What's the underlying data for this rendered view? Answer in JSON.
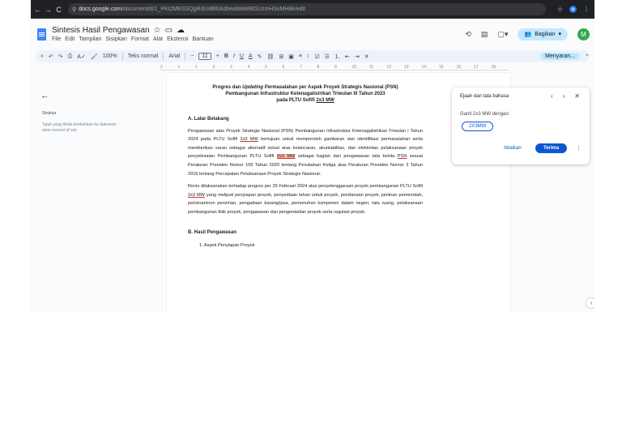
{
  "browser": {
    "nav_back": "←",
    "nav_forward": "→",
    "nav_reload": "C",
    "url_host": "docs.google.com",
    "url_path": "/document/d/1_PKt2MESSQgRdU4Bl0Ad6eaWaWBGUzmHSsMH8k/edit",
    "star": "☆"
  },
  "header": {
    "doc_title": "Sintesis Hasil Pengawasan",
    "menu": [
      "File",
      "Edit",
      "Tampilan",
      "Sisipkan",
      "Format",
      "Alat",
      "Ekstensi",
      "Bantuan"
    ],
    "share_label": "Bagikan",
    "avatar_letter": "M"
  },
  "toolbar": {
    "zoom": "100%",
    "style": "Teks normal",
    "font": "Arial",
    "font_size": "11",
    "mode_label": "Menyaran..."
  },
  "ruler": {
    "ticks": [
      "2",
      "1",
      "1",
      "2",
      "3",
      "4",
      "5",
      "6",
      "7",
      "8",
      "9",
      "10",
      "11",
      "12",
      "13",
      "14",
      "15",
      "16",
      "17",
      "18"
    ]
  },
  "outline": {
    "title": "Struktur",
    "hint": "Tajuk yang Anda tambahkan ke dokumen akan muncul di sini."
  },
  "document": {
    "title_line1_a": "Progres dan ",
    "title_line1_b": "Updating",
    "title_line1_c": " Permasalahan per Aspek Proyek Strategis Nasional (PSN)",
    "title_line2": "Pembangunan Infrastruktur Ketenagalistrikan Triwulan III Tahun 2023",
    "title_line3_a": "pada PLTU Sofifi ",
    "title_line3_b": "2x3 MW",
    "section_a": "A. Latar Belakang",
    "p1_a": "Pengawasan atas Proyek Strategis Nasional (PSN) Pembangunan Infrastruktur Ketenagalistrikan Triwulan I Tahun 2024 pada PLTU Sofifi ",
    "p1_b": "2x3 MW",
    "p1_c": " bertujuan untuk memperoleh gambaran dan identifikasi permasalahan serta memberikan saran sebagai alternatif solusi atas kelancaran, akuntabilitas, dan efektivitas pelaksanaan proyek penyelesaian Pembangunan PLTU Sofifi ",
    "p1_d": "2x3 MW",
    "p1_e": " sebagai bagian dari pengawasan tata kelola ",
    "p1_f": "PSN",
    "p1_g": " sesuai Peraturan Presiden Nomor 109 Tahun 2020 tentang Perubahan Ketiga atas Peraturan Presiden Nomor 3 Tahun 2016 tentang Percepatan Pelaksanaan Proyek Strategis Nasional.",
    "p2_a": "Reviu dilaksanakan terhadap progres per 29 Februari 2024 atas penyelenggaraan proyek pembangunan PLTU Sofifi ",
    "p2_b": "2x3 MW",
    "p2_c": " yang meliputi penyiapan proyek, penyediaan lahan untuk proyek, pendanaan proyek, jaminan pemerintah, perizinan/non perizinan, pengadaan barang/jasa, pemenuhan komponen dalam negeri, tata ruang, pelaksanaan pembangunan fisik proyek, pengawasan dan pengendalian proyek serta regulasi proyek.",
    "section_b": "B. Hasil Pengawasan",
    "list1": "1.   Aspek Penyiapan Proyek"
  },
  "spell_panel": {
    "heading": "Ejaan dan tata bahasa",
    "message": "Ganti 2x3 MW dengan:",
    "suggestion": "2X3MW",
    "ignore_label": "Abaikan",
    "accept_label": "Terima"
  }
}
